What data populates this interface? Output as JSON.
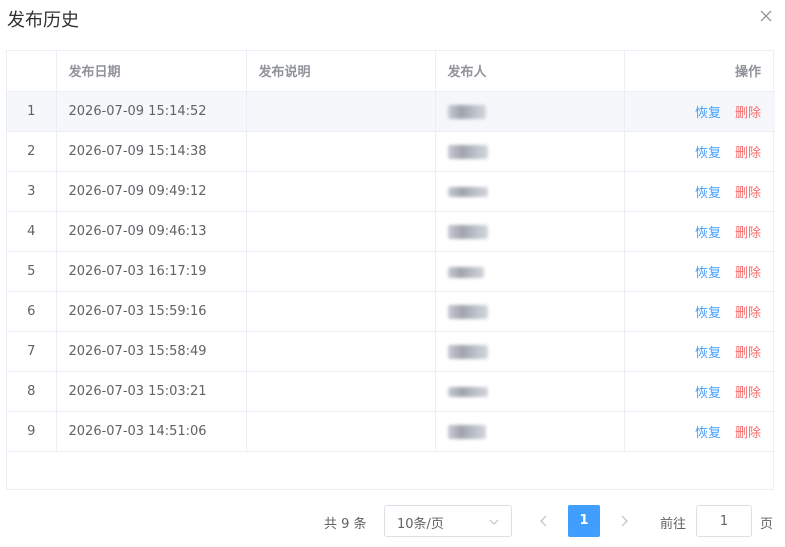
{
  "dialog": {
    "title": "发布历史",
    "close_icon": "close-icon"
  },
  "table": {
    "columns": {
      "index": "",
      "date": "发布日期",
      "desc": "发布说明",
      "publisher": "发布人",
      "actions": "操作"
    },
    "rows": [
      {
        "index": "1",
        "date": "2026-07-09 15:14:52",
        "desc": ""
      },
      {
        "index": "2",
        "date": "2026-07-09 15:14:38",
        "desc": ""
      },
      {
        "index": "3",
        "date": "2026-07-09 09:49:12",
        "desc": ""
      },
      {
        "index": "4",
        "date": "2026-07-09 09:46:13",
        "desc": ""
      },
      {
        "index": "5",
        "date": "2026-07-03 16:17:19",
        "desc": ""
      },
      {
        "index": "6",
        "date": "2026-07-03 15:59:16",
        "desc": ""
      },
      {
        "index": "7",
        "date": "2026-07-03 15:58:49",
        "desc": ""
      },
      {
        "index": "8",
        "date": "2026-07-03 15:03:21",
        "desc": ""
      },
      {
        "index": "9",
        "date": "2026-07-03 14:51:06",
        "desc": ""
      }
    ],
    "actions": {
      "restore": "恢复",
      "delete": "删除"
    }
  },
  "pagination": {
    "total_label": "共 9 条",
    "page_size": "10条/页",
    "current_page": "1",
    "goto_label": "前往",
    "goto_value": "1",
    "page_unit": "页"
  },
  "colors": {
    "primary": "#409eff",
    "danger": "#f56c6c",
    "highlight_row": "#f5f7fa"
  }
}
